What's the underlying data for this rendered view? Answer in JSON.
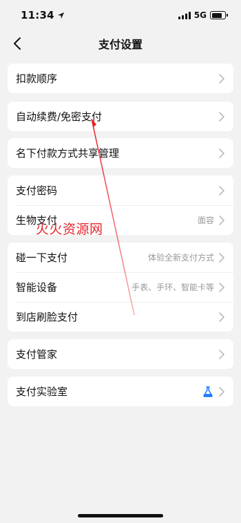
{
  "status_bar": {
    "time": "11:34",
    "network": "5G",
    "battery_level": 0.8
  },
  "nav": {
    "title": "支付设置",
    "back_icon": "chevron-left-icon"
  },
  "groups": [
    {
      "items": [
        {
          "label": "扣款顺序"
        }
      ]
    },
    {
      "items": [
        {
          "label": "自动续费/免密支付"
        }
      ]
    },
    {
      "items": [
        {
          "label": "名下付款方式共享管理"
        }
      ]
    },
    {
      "items": [
        {
          "label": "支付密码"
        },
        {
          "label": "生物支付",
          "value": "面容"
        }
      ]
    },
    {
      "items": [
        {
          "label": "碰一下支付",
          "value": "体验全新支付方式"
        },
        {
          "label": "智能设备",
          "value": "手表、手环、智能卡等"
        },
        {
          "label": "到店刷脸支付"
        }
      ]
    },
    {
      "items": [
        {
          "label": "支付管家"
        }
      ]
    },
    {
      "items": [
        {
          "label": "支付实验室",
          "icon": "flask-icon"
        }
      ]
    }
  ],
  "watermark": {
    "text": "火火资源网",
    "color": "#e8242b"
  },
  "colors": {
    "background": "#f2f2f2",
    "card": "#ffffff",
    "secondary_text": "#999999",
    "accent_blue": "#1677ff",
    "arrow_red": "#e8242b"
  }
}
